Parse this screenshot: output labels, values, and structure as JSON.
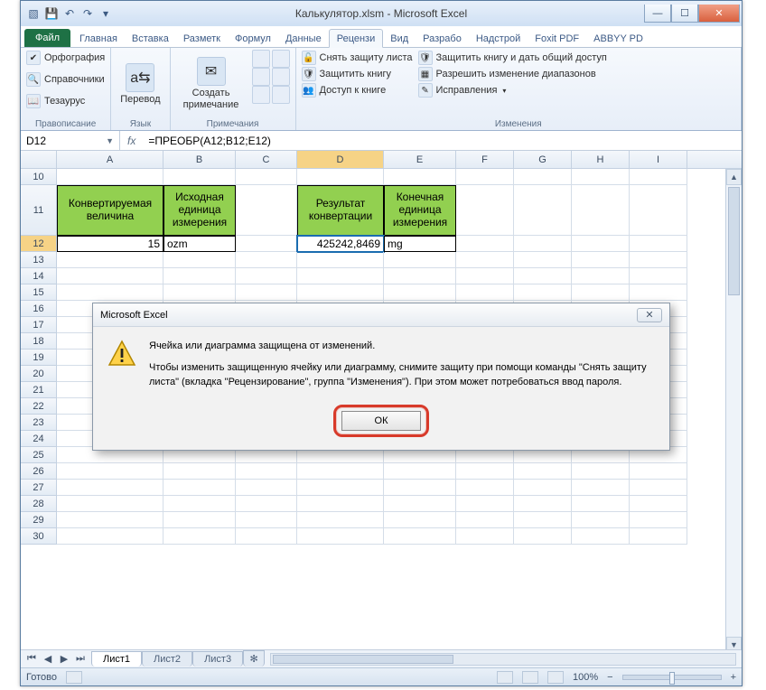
{
  "window": {
    "title": "Калькулятор.xlsm  -  Microsoft Excel"
  },
  "tabs": {
    "file": "Файл",
    "items": [
      "Главная",
      "Вставка",
      "Разметк",
      "Формул",
      "Данные",
      "Рецензи",
      "Вид",
      "Разрабо",
      "Надстрой",
      "Foxit PDF",
      "ABBYY PD"
    ],
    "activeIndex": 5
  },
  "ribbon": {
    "proofing": {
      "label": "Правописание",
      "spell": "Орфография",
      "research": "Справочники",
      "thesaurus": "Тезаурус"
    },
    "language": {
      "label": "Язык",
      "translate": "Перевод"
    },
    "comments": {
      "label": "Примечания",
      "new": "Создать примечание"
    },
    "changes": {
      "label": "Изменения",
      "unprotect": "Снять защиту листа",
      "protectBook": "Защитить книгу",
      "shareBook": "Доступ к книге",
      "protectShare": "Защитить книгу и дать общий доступ",
      "allowRanges": "Разрешить изменение диапазонов",
      "track": "Исправления"
    }
  },
  "namebox": "D12",
  "formula": "=ПРЕОБР(A12;B12;E12)",
  "fx": "fx",
  "columns": [
    "A",
    "B",
    "C",
    "D",
    "E",
    "F",
    "G",
    "H",
    "I"
  ],
  "startRow": 10,
  "headers": {
    "A11": "Конвертируемая величина",
    "B11": "Исходная единица измерения",
    "D11": "Результат конвертации",
    "E11": "Конечная единица измерения"
  },
  "values": {
    "A12": "15",
    "B12": "ozm",
    "D12": "425242,8469",
    "E12": "mg"
  },
  "sheets": {
    "names": [
      "Лист1",
      "Лист2",
      "Лист3"
    ],
    "active": 0
  },
  "status": {
    "ready": "Готово",
    "zoom": "100%"
  },
  "dialog": {
    "title": "Microsoft Excel",
    "line1": "Ячейка или диаграмма защищена от изменений.",
    "line2": "Чтобы изменить защищенную ячейку или диаграмму, снимите защиту при помощи команды \"Снять защиту листа\" (вкладка \"Рецензирование\", группа \"Изменения\"). При этом может потребоваться ввод пароля.",
    "ok": "ОК"
  }
}
